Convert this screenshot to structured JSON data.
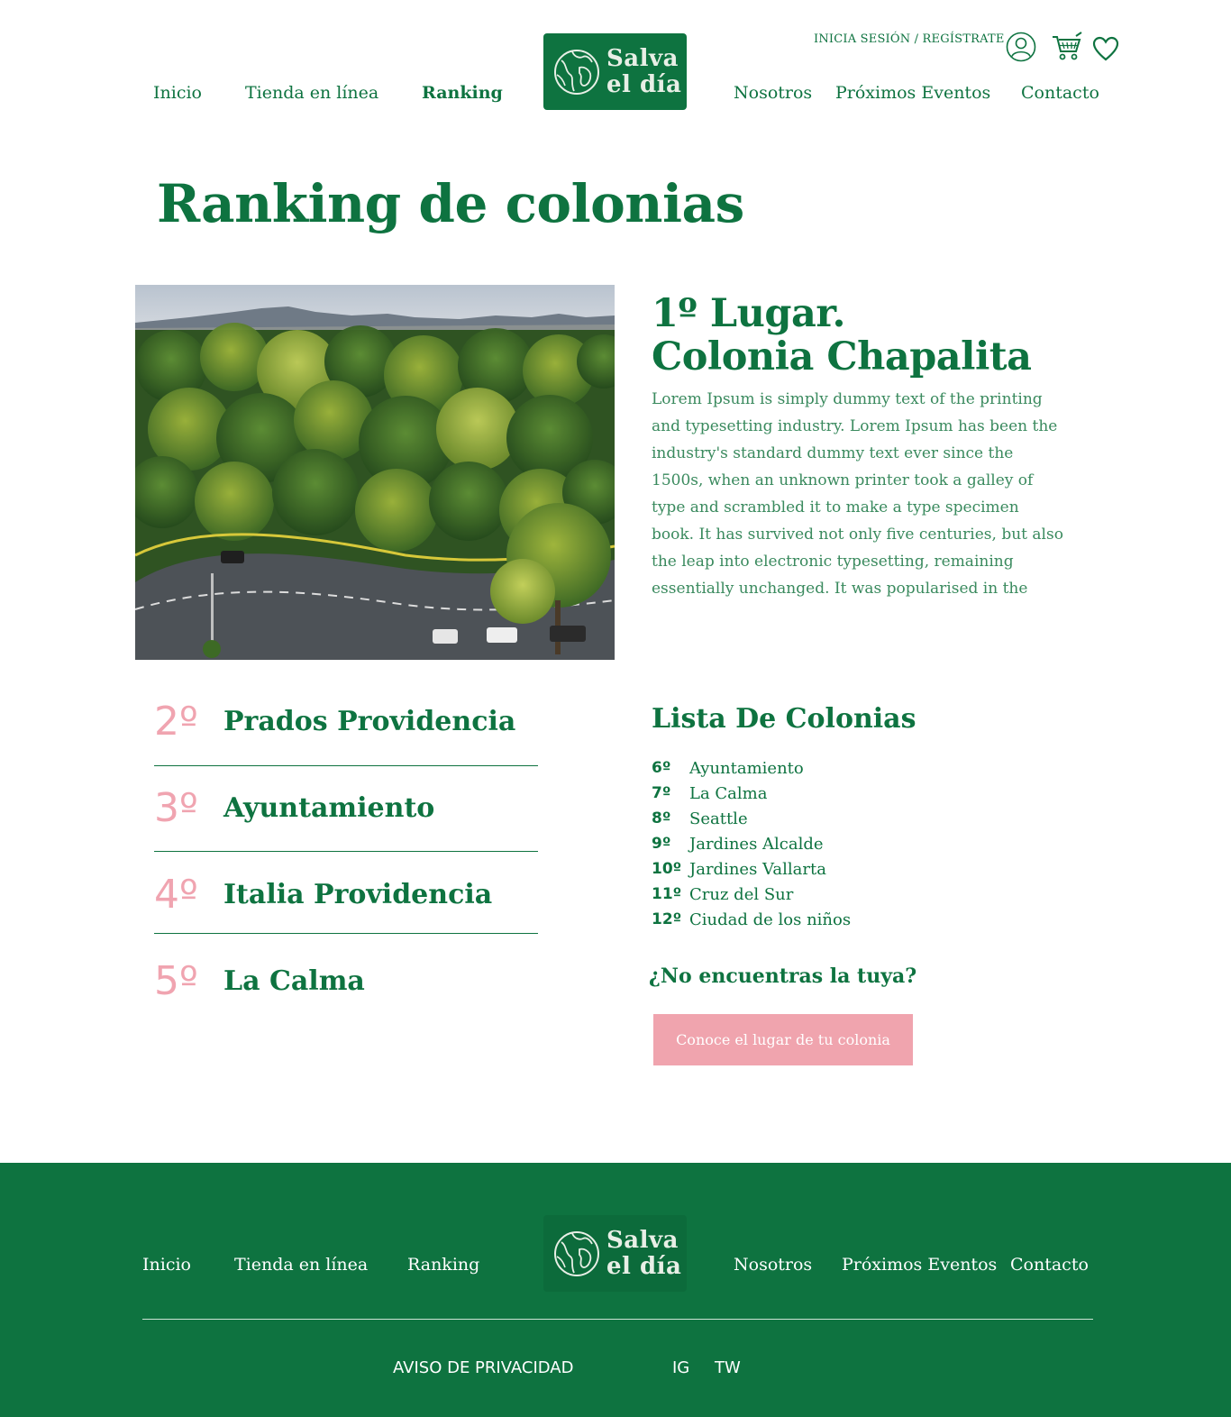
{
  "header": {
    "account_link": "INICIA SESIÓN / REGÍSTRATE",
    "icons": [
      "user-icon",
      "cart-icon",
      "heart-icon"
    ],
    "nav": {
      "inicio": "Inicio",
      "tienda": "Tienda en línea",
      "ranking": "Ranking",
      "nosotros": "Nosotros",
      "eventos": "Próximos Eventos",
      "contacto": "Contacto"
    },
    "active_nav": "Ranking"
  },
  "logo": {
    "line1": "Salva",
    "line2": "el día"
  },
  "page": {
    "title": "Ranking de colonias",
    "first_place": {
      "line1": "1º Lugar.",
      "line2": "Colonia Chapalita",
      "description": "Lorem Ipsum is simply dummy text of the printing and typesetting industry. Lorem Ipsum has been the industry's standard dummy text ever since the 1500s, when an unknown printer took a galley of type and scrambled it to make a type specimen book. It has survived not only five centuries, but also the leap into electronic typesetting, remaining essentially unchanged. It was popularised in the"
    },
    "ranking": [
      {
        "num": "2º",
        "name": "Prados Providencia"
      },
      {
        "num": "3º",
        "name": "Ayuntamiento"
      },
      {
        "num": "4º",
        "name": "Italia Providencia"
      },
      {
        "num": "5º",
        "name": "La Calma"
      }
    ],
    "list_title": "Lista De Colonias",
    "list": [
      {
        "num": "6º",
        "name": "Ayuntamiento"
      },
      {
        "num": "7º",
        "name": "La Calma"
      },
      {
        "num": "8º",
        "name": "Seattle"
      },
      {
        "num": "9º",
        "name": "Jardines Alcalde"
      },
      {
        "num": "10º",
        "name": "Jardines Vallarta"
      },
      {
        "num": "11º",
        "name": "Cruz del Sur"
      },
      {
        "num": "12º",
        "name": "Ciudad de los niños"
      }
    ],
    "cta_question": "¿No encuentras la tuya?",
    "cta_button": "Conoce el lugar de tu colonia"
  },
  "footer": {
    "nav": {
      "inicio": "Inicio",
      "tienda": "Tienda en línea",
      "ranking": "Ranking",
      "nosotros": "Nosotros",
      "eventos": "Próximos Eventos",
      "contacto": "Contacto"
    },
    "privacy": "AVISO DE PRIVACIDAD",
    "ig": "IG",
    "tw": "TW"
  },
  "colors": {
    "brand_green": "#0e7340",
    "accent_pink": "#f0a4ae",
    "text_light_green": "#3a8a5e"
  }
}
